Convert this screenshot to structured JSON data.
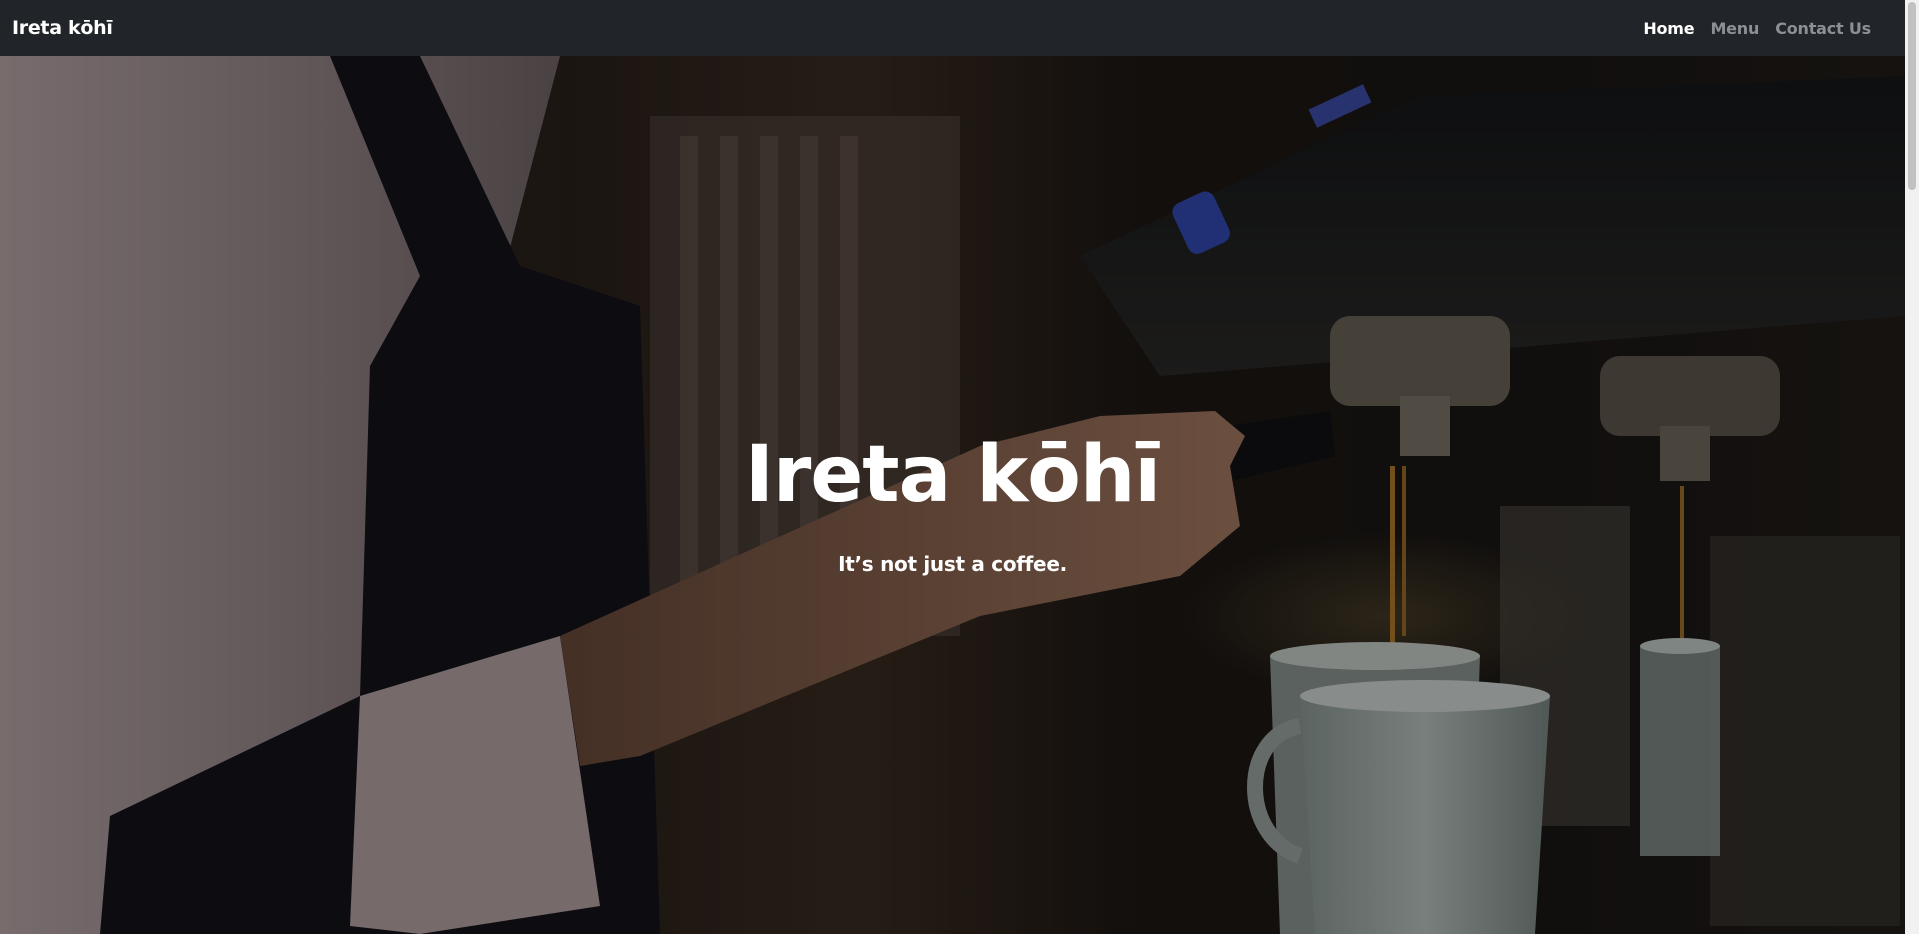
{
  "navbar": {
    "brand": "Ireta kōhī",
    "links": [
      {
        "label": "Home",
        "active": true
      },
      {
        "label": "Menu",
        "active": false
      },
      {
        "label": "Contact Us",
        "active": false
      }
    ]
  },
  "hero": {
    "title": "Ireta kōhī",
    "subtitle": "It’s not just a coffee.",
    "background_image": "barista-espresso-machine-photo"
  },
  "colors": {
    "navbar_bg": "#212529",
    "nav_active": "#ffffff",
    "nav_inactive": "#8c8f93",
    "hero_text": "#ffffff"
  }
}
